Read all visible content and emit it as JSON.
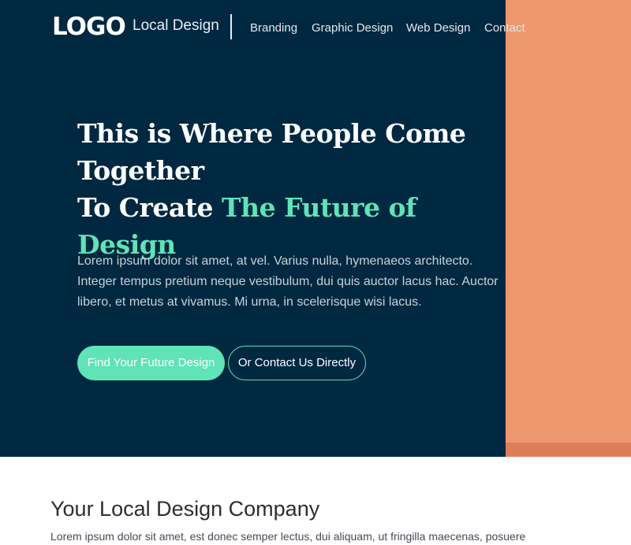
{
  "header": {
    "logo_text": "LOGO",
    "brand_name": "Local Design",
    "nav": [
      {
        "label": "Branding"
      },
      {
        "label": "Graphic Design"
      },
      {
        "label": "Web Design"
      },
      {
        "label": "Contact"
      }
    ]
  },
  "hero": {
    "headline_line1": "This is Where People Come Together",
    "headline_line2_prefix": "To Create ",
    "headline_highlight": "The Future of Design",
    "body": "Lorem ipsum dolor sit amet, at vel. Varius nulla, hymenaeos architecto. Integer tempus pretium neque vestibulum, dui quis auctor lacus hac. Auctor libero, et metus at vivamus. Mi urna, in scelerisque wisi lacus.",
    "primary_button": "Find Your Future Design",
    "secondary_button": "Or Contact Us Directly"
  },
  "section": {
    "title": "Your Local Design Company",
    "text": "Lorem ipsum dolor sit amet, est donec semper lectus, dui aliquam, ut fringilla maecenas, posuere"
  },
  "colors": {
    "hero_background": "#002841",
    "accent_green": "#5fe3b7",
    "accent_orange": "#ef976e"
  }
}
